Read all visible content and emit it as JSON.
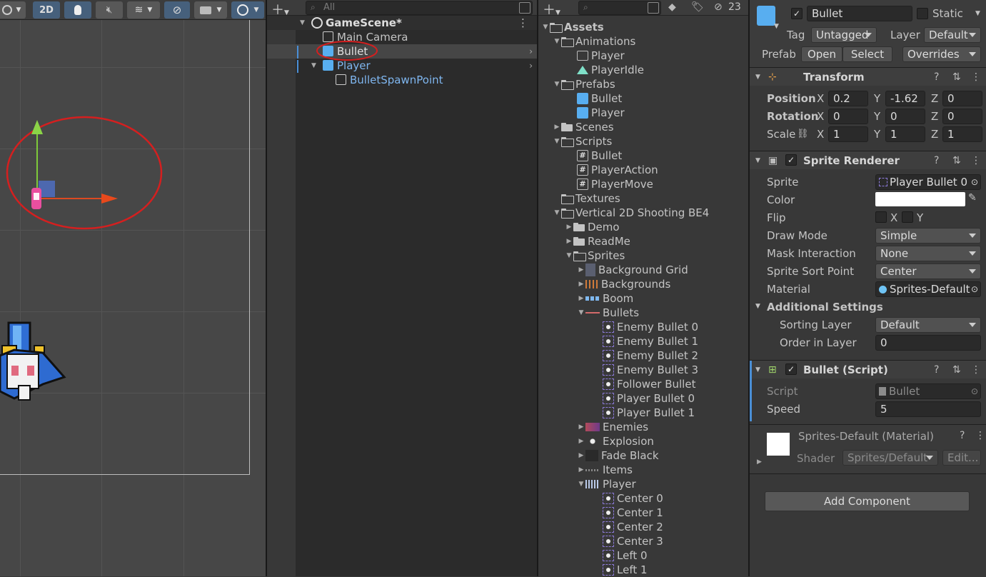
{
  "scene": {
    "toolbar": {
      "mode_2d_label": "2D"
    }
  },
  "hierarchy": {
    "search_placeholder": "All",
    "rows": [
      {
        "label": "GameScene*"
      },
      {
        "label": "Main Camera"
      },
      {
        "label": "Bullet"
      },
      {
        "label": "Player"
      },
      {
        "label": "BulletSpawnPoint"
      }
    ]
  },
  "project": {
    "badge_count": "23",
    "rows": [
      {
        "label": "Assets"
      },
      {
        "label": "Animations"
      },
      {
        "label": "Player"
      },
      {
        "label": "PlayerIdle"
      },
      {
        "label": "Prefabs"
      },
      {
        "label": "Bullet"
      },
      {
        "label": "Player"
      },
      {
        "label": "Scenes"
      },
      {
        "label": "Scripts"
      },
      {
        "label": "Bullet"
      },
      {
        "label": "PlayerAction"
      },
      {
        "label": "PlayerMove"
      },
      {
        "label": "Textures"
      },
      {
        "label": "Vertical 2D Shooting BE4"
      },
      {
        "label": "Demo"
      },
      {
        "label": "ReadMe"
      },
      {
        "label": "Sprites"
      },
      {
        "label": "Background Grid"
      },
      {
        "label": "Backgrounds"
      },
      {
        "label": "Boom"
      },
      {
        "label": "Bullets"
      },
      {
        "label": "Enemy Bullet 0"
      },
      {
        "label": "Enemy Bullet 1"
      },
      {
        "label": "Enemy Bullet 2"
      },
      {
        "label": "Enemy Bullet 3"
      },
      {
        "label": "Follower Bullet"
      },
      {
        "label": "Player Bullet 0"
      },
      {
        "label": "Player Bullet 1"
      },
      {
        "label": "Enemies"
      },
      {
        "label": "Explosion"
      },
      {
        "label": "Fade Black"
      },
      {
        "label": "Items"
      },
      {
        "label": "Player"
      },
      {
        "label": "Center 0"
      },
      {
        "label": "Center 1"
      },
      {
        "label": "Center 2"
      },
      {
        "label": "Center 3"
      },
      {
        "label": "Left 0"
      },
      {
        "label": "Left 1"
      }
    ]
  },
  "inspector": {
    "object_name": "Bullet",
    "static_label": "Static",
    "tag_label": "Tag",
    "tag_value": "Untagged",
    "layer_label": "Layer",
    "layer_value": "Default",
    "prefab_label": "Prefab",
    "open_label": "Open",
    "select_label": "Select",
    "overrides_label": "Overrides",
    "transform": {
      "title": "Transform",
      "position_label": "Position",
      "rotation_label": "Rotation",
      "scale_label": "Scale",
      "x": "X",
      "y": "Y",
      "z": "Z",
      "position": [
        "0.2",
        "-1.62",
        "0"
      ],
      "rotation": [
        "0",
        "0",
        "0"
      ],
      "scale": [
        "1",
        "1",
        "1"
      ]
    },
    "sprite_renderer": {
      "title": "Sprite Renderer",
      "sprite_label": "Sprite",
      "sprite_value": "Player Bullet 0",
      "color_label": "Color",
      "color_value": "#ffffff",
      "flip_label": "Flip",
      "flip_x": "X",
      "flip_y": "Y",
      "draw_mode_label": "Draw Mode",
      "draw_mode_value": "Simple",
      "mask_label": "Mask Interaction",
      "mask_value": "None",
      "sort_point_label": "Sprite Sort Point",
      "sort_point_value": "Center",
      "material_label": "Material",
      "material_value": "Sprites-Default",
      "additional_label": "Additional Settings",
      "sorting_layer_label": "Sorting Layer",
      "sorting_layer_value": "Default",
      "order_label": "Order in Layer",
      "order_value": "0"
    },
    "bullet_script": {
      "title": "Bullet (Script)",
      "script_label": "Script",
      "script_value": "Bullet",
      "speed_label": "Speed",
      "speed_value": "5"
    },
    "material": {
      "title": "Sprites-Default (Material)",
      "shader_label": "Shader",
      "shader_value": "Sprites/Default",
      "edit_label": "Edit..."
    },
    "add_component_label": "Add Component"
  }
}
